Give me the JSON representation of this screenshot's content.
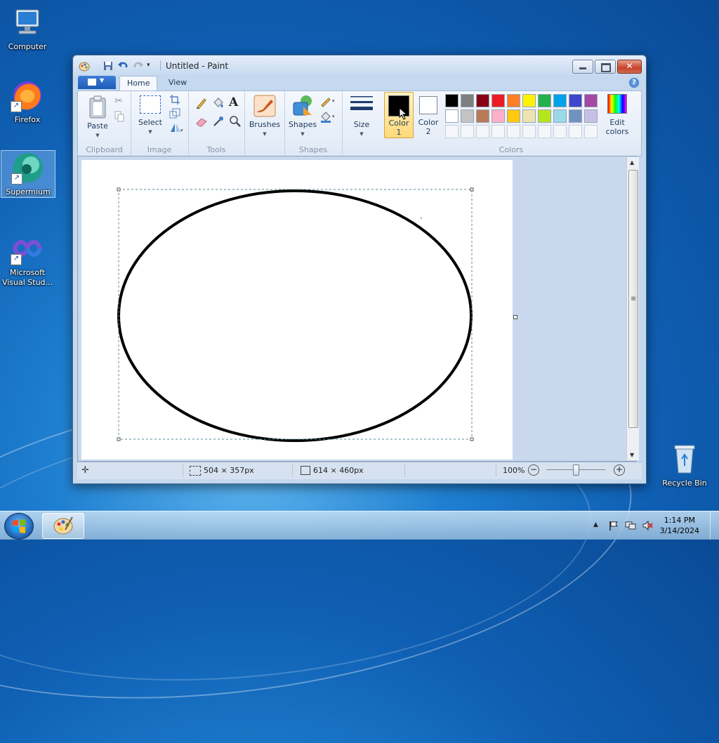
{
  "desktop": {
    "icons": [
      {
        "label": "Computer"
      },
      {
        "label": "Firefox"
      },
      {
        "label": "Supermium"
      },
      {
        "label": "Microsoft Visual Stud..."
      },
      {
        "label": "Recycle Bin"
      }
    ]
  },
  "window": {
    "title": "Untitled - Paint",
    "tabs": [
      "Home",
      "View"
    ],
    "help": "?"
  },
  "ribbon": {
    "clipboard": {
      "paste": "Paste",
      "group": "Clipboard"
    },
    "image": {
      "select": "Select",
      "group": "Image"
    },
    "tools": {
      "group": "Tools",
      "text_tool": "A"
    },
    "brushes": {
      "label": "Brushes"
    },
    "shapes": {
      "label": "Shapes",
      "group": "Shapes"
    },
    "size": {
      "label": "Size"
    },
    "color1": {
      "line1": "Color",
      "line2": "1",
      "value": "#000000"
    },
    "color2": {
      "line1": "Color",
      "line2": "2",
      "value": "#ffffff"
    },
    "colors_group": "Colors",
    "edit_colors": {
      "line1": "Edit",
      "line2": "colors"
    },
    "palette": [
      "#000000",
      "#7f7f7f",
      "#880015",
      "#ed1c24",
      "#ff7f27",
      "#fff200",
      "#22b14c",
      "#00a2e8",
      "#3f48cc",
      "#a349a4",
      "#ffffff",
      "#c3c3c3",
      "#b97a57",
      "#ffaec9",
      "#ffc90e",
      "#efe4b0",
      "#b5e61d",
      "#99d9ea",
      "#7092be",
      "#c8bfe7"
    ],
    "custom_slots": 10
  },
  "statusbar": {
    "selection_size": "504 × 357px",
    "canvas_size": "614 × 460px",
    "zoom": "100%"
  },
  "taskbar": {
    "time": "1:14 PM",
    "date": "3/14/2024"
  }
}
